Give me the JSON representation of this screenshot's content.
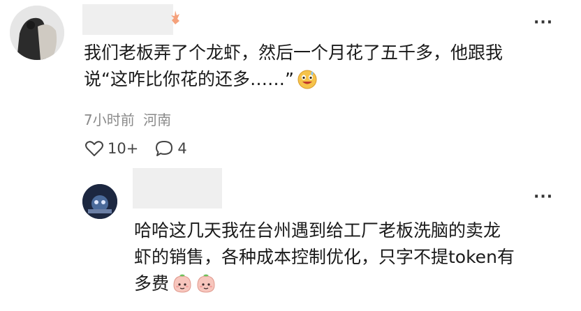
{
  "comment": {
    "text_line1": "我们老板弄了个龙虾，然后一个月花了五千多，他跟我",
    "text_line2": "说“这咋比你花的还多……”",
    "emoji": "grin-sweat-emoji",
    "time": "7小时前",
    "location": "河南",
    "likes": "10+",
    "replies": "4",
    "more": "···"
  },
  "reply": {
    "text_line1": "哈哈这几天我在台州遇到给工厂老板洗脑的卖龙",
    "text_line2": "虾的销售，各种成本控制优化，只字不提token有",
    "text_line3": "多费",
    "emoji": "peach-emoji",
    "more": "···"
  },
  "colors": {
    "text": "#1a1a1a",
    "meta": "#8a8a8a"
  }
}
